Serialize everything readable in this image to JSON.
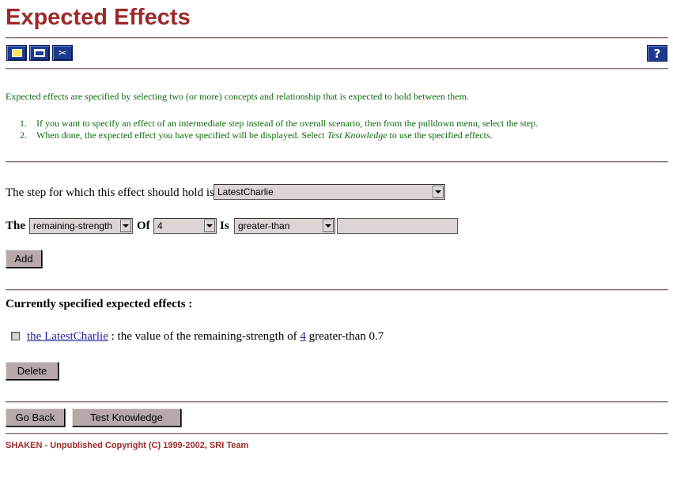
{
  "page": {
    "title": "Expected Effects"
  },
  "toolbar": {
    "icons": [
      "new-icon",
      "print-icon",
      "tools-icon"
    ],
    "help_label": "?"
  },
  "intro": {
    "text": "Expected effects are specified by selecting two (or more) concepts and relationship that is expected to hold between them.",
    "steps": [
      {
        "num": "1.",
        "text": "If you want to specify an effect of an intermediate step instead of the overall scenario, then from the pulldown menu, select the step."
      },
      {
        "num": "2.",
        "text_before": "When done, the expected effect you have specified will be displayed. Select ",
        "text_italic": "Test Knowledge",
        "text_after": " to use the specified effects."
      }
    ]
  },
  "form": {
    "step_prompt": "The step for which this effect should hold is",
    "step_value": "LatestCharlie",
    "the_label": "The",
    "property_value": "remaining-strength",
    "of_label": "Of",
    "object_value": "4",
    "is_label": "Is",
    "relation_value": "greater-than",
    "value_input": "",
    "add_label": "Add"
  },
  "current": {
    "heading": "Currently specified expected effects :",
    "effects": [
      {
        "subject_link": "the LatestCharlie",
        "middle": " : the value of the remaining-strength of ",
        "object_link": "4",
        "tail": " greater-than 0.7"
      }
    ],
    "delete_label": "Delete"
  },
  "nav": {
    "back_label": "Go Back",
    "test_label": "Test Knowledge"
  },
  "footer": {
    "copyright": "SHAKEN - Unpublished Copyright (C) 1999-2002, SRI Team"
  },
  "colors": {
    "title": "#9b2a2a",
    "instructions": "#0d6b0d",
    "link": "#1f1fa0",
    "button": "#b7a9a9",
    "toolbar_icon_bg": "#1d3b8e"
  }
}
